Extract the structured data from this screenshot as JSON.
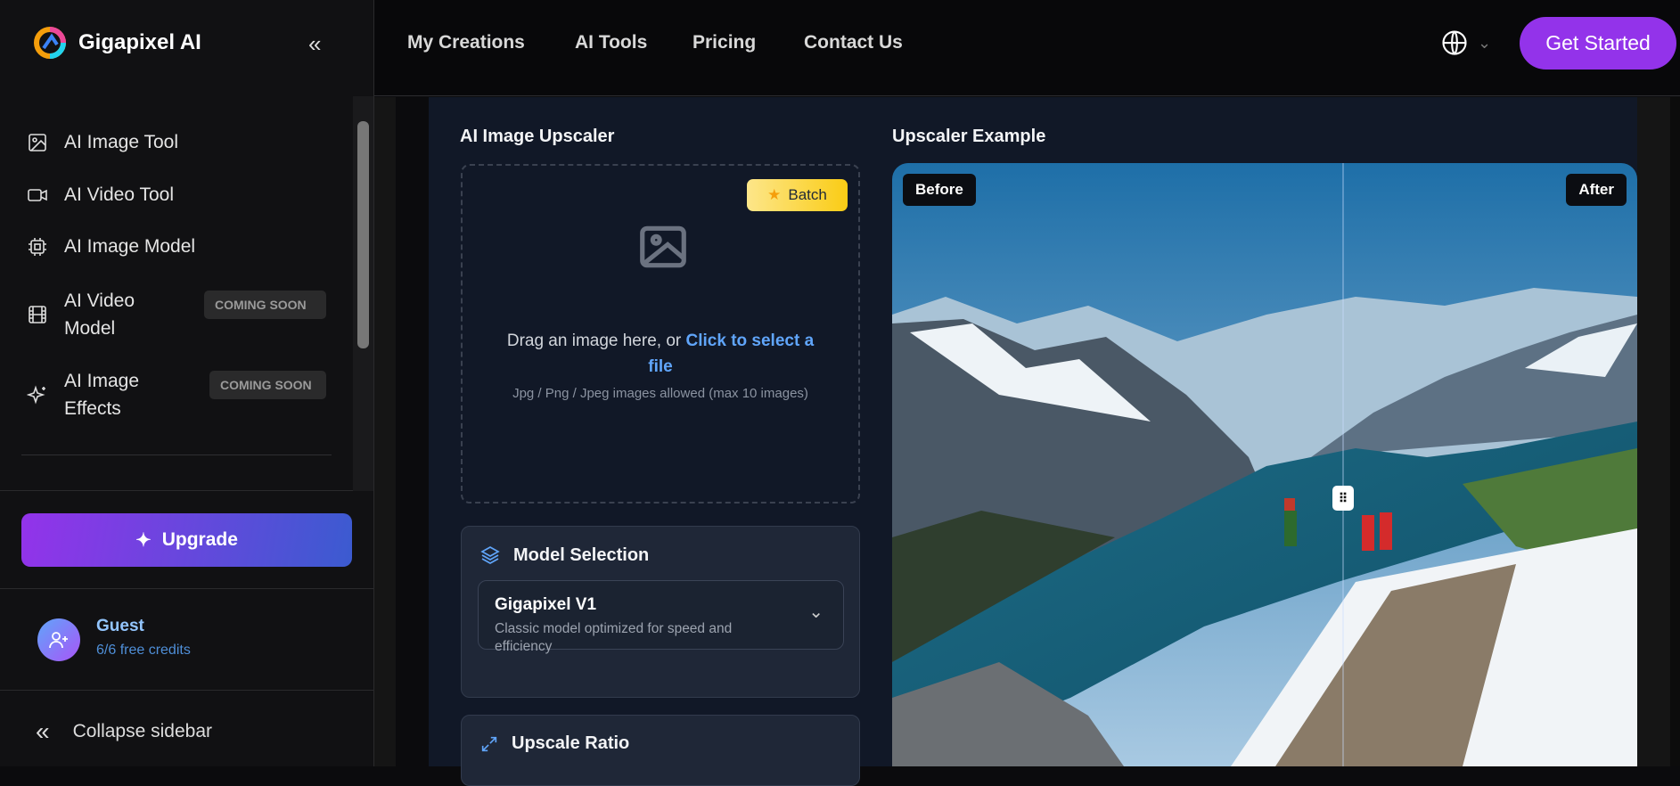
{
  "brand": {
    "name": "Gigapixel AI"
  },
  "sidebar": {
    "items": [
      {
        "label": "AI Image Tool",
        "icon": "image-icon"
      },
      {
        "label": "AI Video Tool",
        "icon": "video-icon"
      },
      {
        "label": "AI Image Model",
        "icon": "chip-icon"
      },
      {
        "label": "AI Video Model",
        "icon": "film-icon",
        "badge": "COMING SOON"
      },
      {
        "label": "AI Image Effects",
        "icon": "sparkles-icon",
        "badge": "COMING SOON"
      }
    ],
    "upgrade_label": "Upgrade",
    "user": {
      "name": "Guest",
      "credits": "6/6 free credits"
    },
    "collapse_label": "Collapse sidebar"
  },
  "header": {
    "nav": [
      "My Creations",
      "AI Tools",
      "Pricing",
      "Contact Us"
    ],
    "cta": "Get Started"
  },
  "upscaler": {
    "title": "AI Image Upscaler",
    "batch_label": "Batch",
    "drag_text": "Drag an image here, or ",
    "link_text": "Click to select a file",
    "hint": "Jpg / Png / Jpeg images allowed (max 10 images)",
    "model_title": "Model Selection",
    "model_name": "Gigapixel V1",
    "model_desc": "Classic model optimized for speed and efficiency",
    "ratio_title": "Upscale Ratio"
  },
  "example": {
    "title": "Upscaler Example",
    "before": "Before",
    "after": "After"
  },
  "colors": {
    "accent": "#9333ea",
    "link": "#60a5fa",
    "panel": "#111827"
  }
}
